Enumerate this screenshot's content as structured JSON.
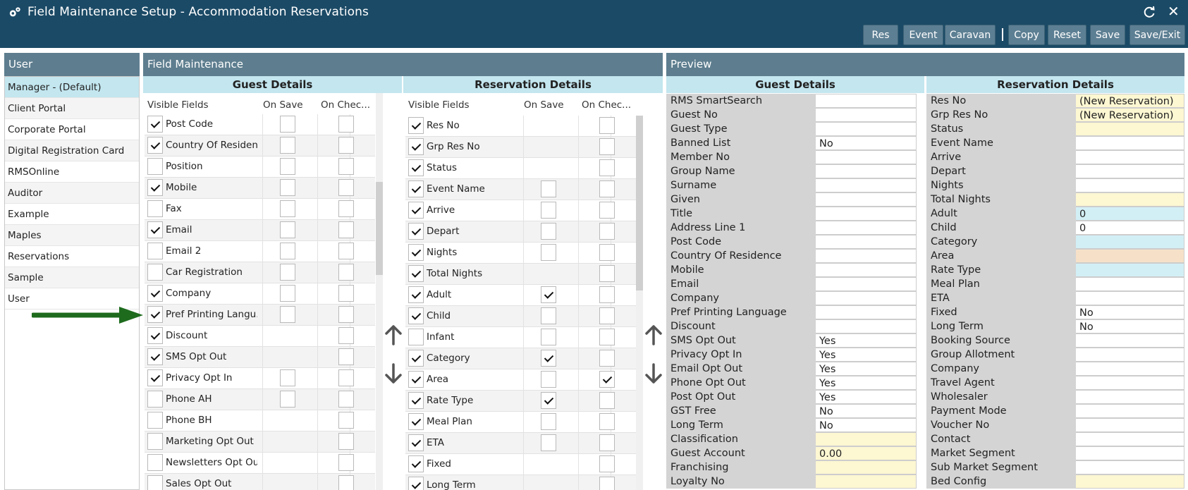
{
  "window": {
    "title": "Field Maintenance Setup - Accommodation Reservations"
  },
  "toolbar": {
    "buttons": [
      "Res",
      "Event",
      "Caravan",
      "Copy",
      "Reset",
      "Save",
      "Save/Exit"
    ]
  },
  "user_panel": {
    "title": "User",
    "items": [
      "Manager - (Default)",
      "Client Portal",
      "Corporate Portal",
      "Digital Registration Card",
      "RMSOnline",
      "Auditor",
      "Example",
      "Maples",
      "Reservations",
      "Sample",
      "User"
    ],
    "selected": 0
  },
  "field_maintenance": {
    "title": "Field Maintenance",
    "guest": {
      "title": "Guest Details",
      "headers": [
        "Visible Fields",
        "On Save",
        "On Chec..."
      ],
      "rows": [
        {
          "label": "Post Code",
          "visible": true,
          "save": "box",
          "checkin": "box"
        },
        {
          "label": "Country Of Residen...",
          "visible": true,
          "save": "box",
          "checkin": "box"
        },
        {
          "label": "Position",
          "visible": false,
          "save": "box",
          "checkin": "box"
        },
        {
          "label": "Mobile",
          "visible": true,
          "save": "box",
          "checkin": "box"
        },
        {
          "label": "Fax",
          "visible": false,
          "save": "box",
          "checkin": "box"
        },
        {
          "label": "Email",
          "visible": true,
          "save": "box",
          "checkin": "box"
        },
        {
          "label": "Email 2",
          "visible": false,
          "save": "box",
          "checkin": "box"
        },
        {
          "label": "Car Registration",
          "visible": false,
          "save": "box",
          "checkin": "box"
        },
        {
          "label": "Company",
          "visible": true,
          "save": "box",
          "checkin": "box"
        },
        {
          "label": "Pref Printing Langu...",
          "visible": true,
          "save": "box",
          "checkin": "box"
        },
        {
          "label": "Discount",
          "visible": true,
          "save": "none",
          "checkin": "box"
        },
        {
          "label": "SMS Opt Out",
          "visible": true,
          "save": "none",
          "checkin": "box"
        },
        {
          "label": "Privacy Opt In",
          "visible": true,
          "save": "box",
          "checkin": "box"
        },
        {
          "label": "Phone AH",
          "visible": false,
          "save": "box",
          "checkin": "box"
        },
        {
          "label": "Phone BH",
          "visible": false,
          "save": "none",
          "checkin": "box"
        },
        {
          "label": "Marketing Opt Out",
          "visible": false,
          "save": "none",
          "checkin": "box"
        },
        {
          "label": "Newsletters Opt Out",
          "visible": false,
          "save": "none",
          "checkin": "box"
        },
        {
          "label": "Sales Opt Out",
          "visible": false,
          "save": "none",
          "checkin": "box"
        }
      ]
    },
    "reservation": {
      "title": "Reservation Details",
      "headers": [
        "Visible Fields",
        "On Save",
        "On Chec..."
      ],
      "rows": [
        {
          "label": "Res No",
          "visible": true,
          "save": "none",
          "checkin": "box"
        },
        {
          "label": "Grp Res No",
          "visible": true,
          "save": "none",
          "checkin": "box"
        },
        {
          "label": "Status",
          "visible": true,
          "save": "none",
          "checkin": "box"
        },
        {
          "label": "Event Name",
          "visible": true,
          "save": "box",
          "checkin": "box"
        },
        {
          "label": "Arrive",
          "visible": true,
          "save": "box",
          "checkin": "box"
        },
        {
          "label": "Depart",
          "visible": true,
          "save": "box",
          "checkin": "box"
        },
        {
          "label": "Nights",
          "visible": true,
          "save": "box",
          "checkin": "box"
        },
        {
          "label": "Total Nights",
          "visible": true,
          "save": "none",
          "checkin": "box"
        },
        {
          "label": "Adult",
          "visible": true,
          "save": "on",
          "checkin": "box"
        },
        {
          "label": "Child",
          "visible": true,
          "save": "box",
          "checkin": "box"
        },
        {
          "label": "Infant",
          "visible": false,
          "save": "box",
          "checkin": "box"
        },
        {
          "label": "Category",
          "visible": true,
          "save": "on",
          "checkin": "box"
        },
        {
          "label": "Area",
          "visible": true,
          "save": "box",
          "checkin": "on"
        },
        {
          "label": "Rate Type",
          "visible": true,
          "save": "on",
          "checkin": "box"
        },
        {
          "label": "Meal Plan",
          "visible": true,
          "save": "box",
          "checkin": "box"
        },
        {
          "label": "ETA",
          "visible": true,
          "save": "box",
          "checkin": "box"
        },
        {
          "label": "Fixed",
          "visible": true,
          "save": "none",
          "checkin": "box"
        },
        {
          "label": "Long Term",
          "visible": true,
          "save": "none",
          "checkin": "box"
        }
      ]
    }
  },
  "preview": {
    "title": "Preview",
    "guest": {
      "title": "Guest Details",
      "rows": [
        {
          "label": "RMS SmartSearch",
          "value": "",
          "bg": "#ffffff"
        },
        {
          "label": "Guest No",
          "value": "",
          "bg": "#ffffff"
        },
        {
          "label": "Guest Type",
          "value": "",
          "bg": "#ffffff"
        },
        {
          "label": "Banned List",
          "value": "No",
          "bg": "#ffffff"
        },
        {
          "label": "Member No",
          "value": "",
          "bg": "#ffffff"
        },
        {
          "label": "Group Name",
          "value": "",
          "bg": "#ffffff"
        },
        {
          "label": "Surname",
          "value": "",
          "bg": "#ffffff"
        },
        {
          "label": "Given",
          "value": "",
          "bg": "#ffffff"
        },
        {
          "label": "Title",
          "value": "",
          "bg": "#ffffff"
        },
        {
          "label": "Address Line 1",
          "value": "",
          "bg": "#ffffff"
        },
        {
          "label": "Post Code",
          "value": "",
          "bg": "#ffffff"
        },
        {
          "label": "Country Of Residence",
          "value": "",
          "bg": "#ffffff"
        },
        {
          "label": "Mobile",
          "value": "",
          "bg": "#ffffff"
        },
        {
          "label": "Email",
          "value": "",
          "bg": "#ffffff"
        },
        {
          "label": "Company",
          "value": "",
          "bg": "#ffffff"
        },
        {
          "label": "Pref Printing Language",
          "value": "",
          "bg": "#ffffff"
        },
        {
          "label": "Discount",
          "value": "",
          "bg": "#ffffff"
        },
        {
          "label": "SMS Opt Out",
          "value": "Yes",
          "bg": "#ffffff"
        },
        {
          "label": "Privacy Opt In",
          "value": "Yes",
          "bg": "#ffffff"
        },
        {
          "label": "Email Opt Out",
          "value": "Yes",
          "bg": "#ffffff"
        },
        {
          "label": "Phone Opt Out",
          "value": "Yes",
          "bg": "#ffffff"
        },
        {
          "label": "Post Opt Out",
          "value": "Yes",
          "bg": "#ffffff"
        },
        {
          "label": "GST Free",
          "value": "No",
          "bg": "#ffffff"
        },
        {
          "label": "Long Term",
          "value": "No",
          "bg": "#ffffff"
        },
        {
          "label": "Classification",
          "value": "",
          "bg": "#fdf7d2"
        },
        {
          "label": "Guest Account",
          "value": "0.00",
          "bg": "#fdf7d2"
        },
        {
          "label": "Franchising",
          "value": "",
          "bg": "#fdf7d2"
        },
        {
          "label": "Loyalty No",
          "value": "",
          "bg": "#fdf7d2"
        }
      ]
    },
    "reservation": {
      "title": "Reservation Details",
      "rows": [
        {
          "label": "Res No",
          "value": "(New Reservation)",
          "bg": "#fdf7d2"
        },
        {
          "label": "Grp Res No",
          "value": "(New Reservation)",
          "bg": "#fdf7d2"
        },
        {
          "label": "Status",
          "value": "",
          "bg": "#fdf7d2"
        },
        {
          "label": "Event Name",
          "value": "",
          "bg": "#ffffff"
        },
        {
          "label": "Arrive",
          "value": "",
          "bg": "#ffffff"
        },
        {
          "label": "Depart",
          "value": "",
          "bg": "#ffffff"
        },
        {
          "label": "Nights",
          "value": "",
          "bg": "#ffffff"
        },
        {
          "label": "Total Nights",
          "value": "",
          "bg": "#fdf7d2"
        },
        {
          "label": "Adult",
          "value": "0",
          "bg": "#d3eff6"
        },
        {
          "label": "Child",
          "value": "0",
          "bg": "#ffffff"
        },
        {
          "label": "Category",
          "value": "",
          "bg": "#d3eff6"
        },
        {
          "label": "Area",
          "value": "",
          "bg": "#f6e1c8"
        },
        {
          "label": "Rate Type",
          "value": "",
          "bg": "#d3eff6"
        },
        {
          "label": "Meal Plan",
          "value": "",
          "bg": "#ffffff"
        },
        {
          "label": "ETA",
          "value": "",
          "bg": "#ffffff"
        },
        {
          "label": "Fixed",
          "value": "No",
          "bg": "#ffffff"
        },
        {
          "label": "Long Term",
          "value": "No",
          "bg": "#ffffff"
        },
        {
          "label": "Booking Source",
          "value": "",
          "bg": "#ffffff"
        },
        {
          "label": "Group Allotment",
          "value": "",
          "bg": "#ffffff"
        },
        {
          "label": "Company",
          "value": "",
          "bg": "#ffffff"
        },
        {
          "label": "Travel Agent",
          "value": "",
          "bg": "#ffffff"
        },
        {
          "label": "Wholesaler",
          "value": "",
          "bg": "#ffffff"
        },
        {
          "label": "Payment Mode",
          "value": "",
          "bg": "#ffffff"
        },
        {
          "label": "Voucher No",
          "value": "",
          "bg": "#ffffff"
        },
        {
          "label": "Contact",
          "value": "",
          "bg": "#ffffff"
        },
        {
          "label": "Market Segment",
          "value": "",
          "bg": "#ffffff"
        },
        {
          "label": "Sub Market Segment",
          "value": "",
          "bg": "#ffffff"
        },
        {
          "label": "Bed Config",
          "value": "",
          "bg": "#fdf7d2"
        }
      ]
    }
  },
  "colors": {
    "titlebar": "#1b4a66",
    "button": "#5d7f93",
    "panel_header": "#5e7e8f",
    "column_header": "#c3e6ef",
    "annotation_arrow": "#1e6b1e"
  },
  "icons": [
    "settings-icon",
    "refresh-icon",
    "close-icon",
    "move-up-icon",
    "move-down-icon",
    "annotation-arrow"
  ]
}
